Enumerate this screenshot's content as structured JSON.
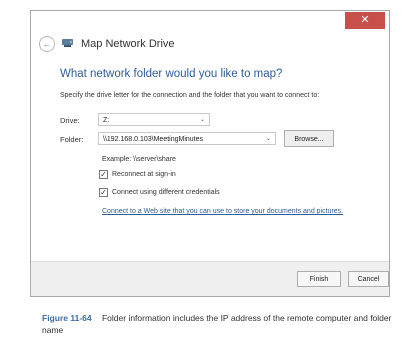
{
  "window": {
    "close_label": "✕",
    "title": "Map Network Drive",
    "heading": "What network folder would you like to map?",
    "description": "Specify the drive letter for the connection and the folder that you want to connect to:",
    "drive": {
      "label": "Drive:",
      "value": "Z:"
    },
    "folder": {
      "label": "Folder:",
      "value": "\\\\192.168.0.103\\MeetingMinutes"
    },
    "browse_label": "Browse...",
    "example": "Example: \\\\server\\share",
    "reconnect": {
      "label": "Reconnect at sign-in",
      "checked": true
    },
    "credentials": {
      "label": "Connect using different credentials",
      "checked": true
    },
    "web_link": "Connect to a Web site that you can use to store your documents and pictures.",
    "finish_label": "Finish",
    "cancel_label": "Cancel"
  },
  "caption": {
    "figure": "Figure 11-64",
    "text": "Folder information includes the IP address of the remote computer and folder name"
  }
}
